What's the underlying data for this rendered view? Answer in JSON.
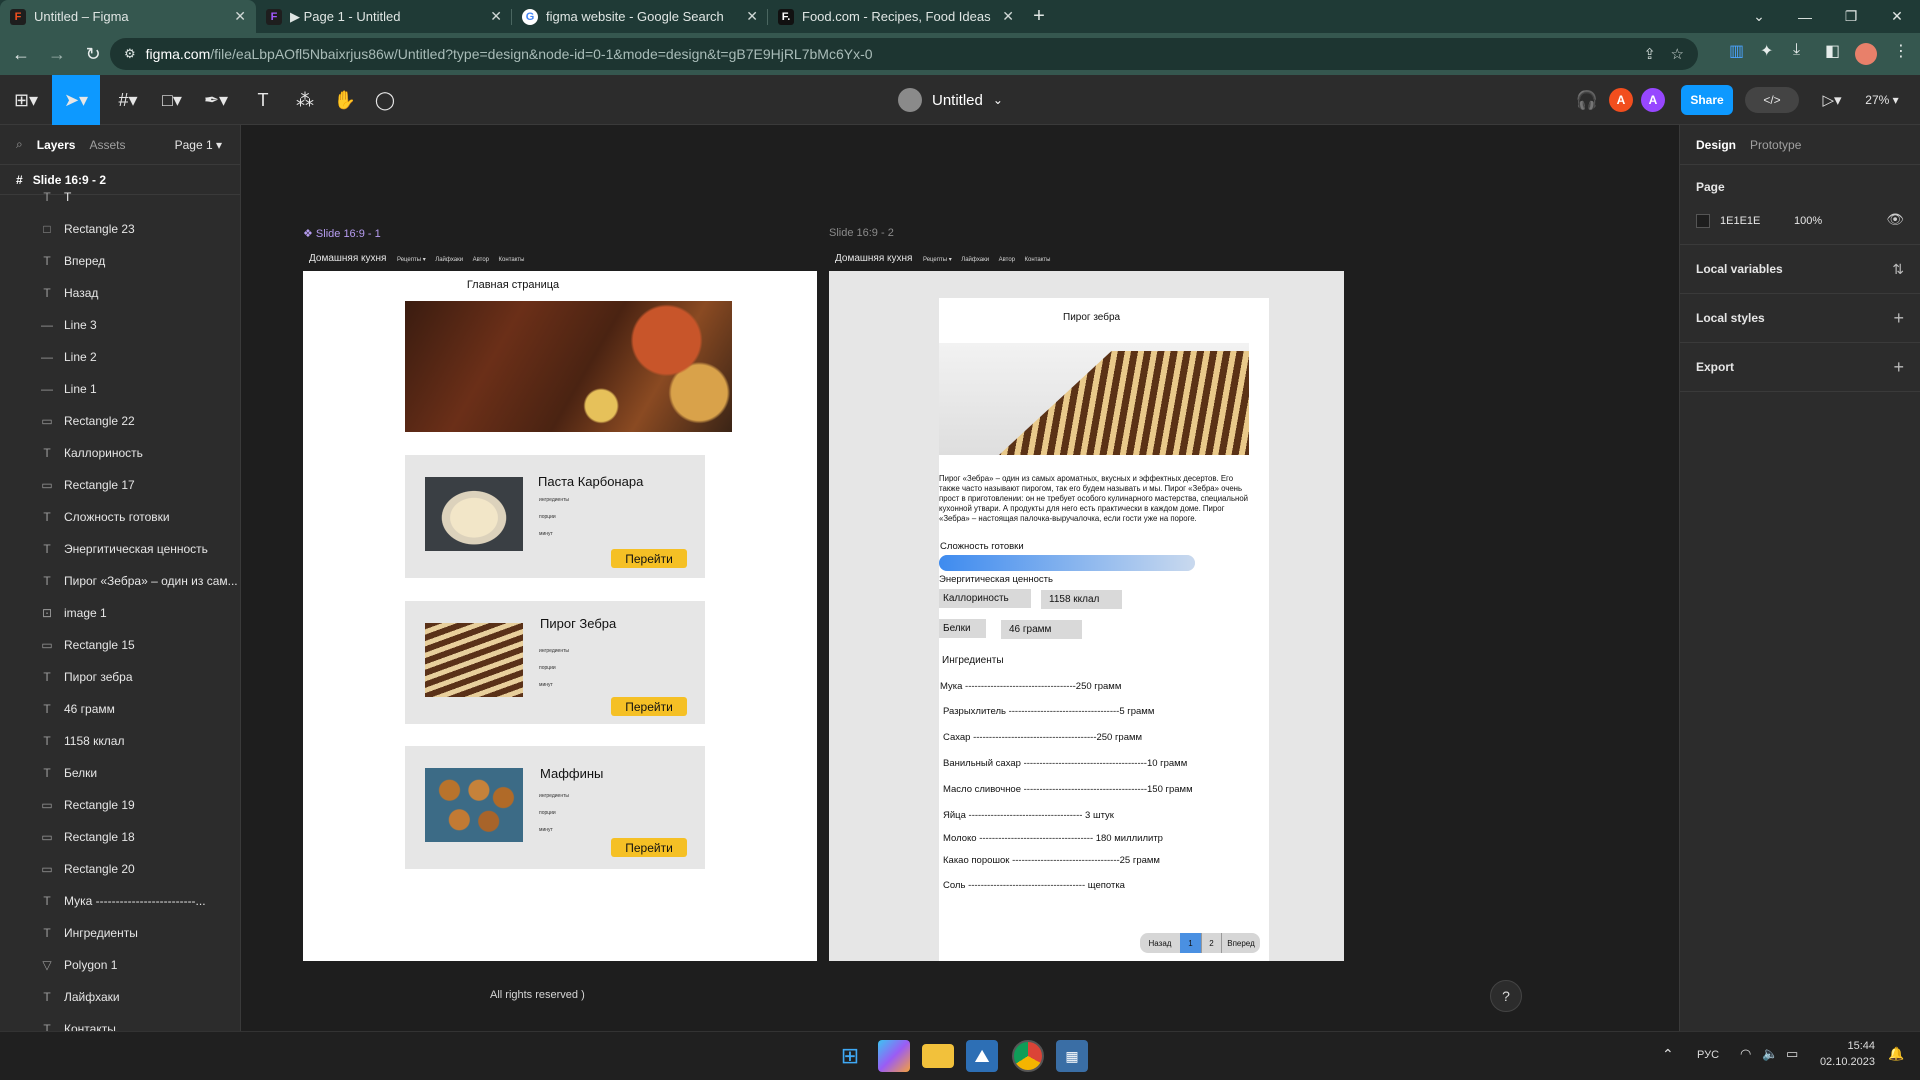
{
  "browser": {
    "tabs": [
      {
        "title": "Untitled – Figma",
        "active": true,
        "icon": "figma-icon"
      },
      {
        "title": "▶ Page 1 - Untitled",
        "active": false,
        "icon": "figma-icon"
      },
      {
        "title": "figma website - Google Search",
        "active": false,
        "icon": "google-icon"
      },
      {
        "title": "Food.com - Recipes, Food Ideas",
        "active": false,
        "icon": "food-icon"
      }
    ],
    "new_tab": "+",
    "window_controls": {
      "chevron": "⌄",
      "minimize": "—",
      "restore": "❐",
      "close": "✕"
    },
    "url_host": "figma.com",
    "url_rest": "/file/eaLbpAOfl5Nbaixrjus86w/Untitled?type=design&node-id=0-1&mode=design&t=gB7E9HjRL7bMc6Yx-0",
    "nav": {
      "back": "←",
      "forward": "→",
      "reload": "↻"
    }
  },
  "figma_toolbar": {
    "file_title": "Untitled",
    "file_chevron": "⌄",
    "share_label": "Share",
    "zoom": "27%",
    "avatars": [
      {
        "letter": "A",
        "color": "#f24e1e"
      },
      {
        "letter": "A",
        "color": "#9747ff"
      }
    ],
    "accent": "#0d99ff"
  },
  "left_panel": {
    "tab_layers": "Layers",
    "tab_assets": "Assets",
    "page_selector": "Page 1",
    "frame_name": "Slide 16:9 - 2",
    "layers": [
      {
        "name": "T",
        "icon": "T"
      },
      {
        "name": "Rectangle 23",
        "icon": "□"
      },
      {
        "name": "Вперед",
        "icon": "T"
      },
      {
        "name": "Назад",
        "icon": "T"
      },
      {
        "name": "Line 3",
        "icon": "—"
      },
      {
        "name": "Line 2",
        "icon": "—"
      },
      {
        "name": "Line 1",
        "icon": "—"
      },
      {
        "name": "Rectangle 22",
        "icon": "▭"
      },
      {
        "name": "Каллориность",
        "icon": "T"
      },
      {
        "name": "Rectangle 17",
        "icon": "▭"
      },
      {
        "name": "Сложность готовки",
        "icon": "T"
      },
      {
        "name": "Энергитическая ценность",
        "icon": "T"
      },
      {
        "name": "Пирог «Зебра» – один из сам...",
        "icon": "T"
      },
      {
        "name": "image 1",
        "icon": "⊡"
      },
      {
        "name": "Rectangle 15",
        "icon": "▭"
      },
      {
        "name": "Пирог зебра",
        "icon": "T"
      },
      {
        "name": "46 грамм",
        "icon": "T"
      },
      {
        "name": "1158 кклал",
        "icon": "T"
      },
      {
        "name": "Белки",
        "icon": "T"
      },
      {
        "name": "Rectangle 19",
        "icon": "▭"
      },
      {
        "name": "Rectangle 18",
        "icon": "▭"
      },
      {
        "name": "Rectangle 20",
        "icon": "▭"
      },
      {
        "name": "Мука -------------------------...",
        "icon": "T"
      },
      {
        "name": "Ингредиенты",
        "icon": "T"
      },
      {
        "name": "Polygon 1",
        "icon": "▽"
      },
      {
        "name": "Лайфхаки",
        "icon": "T"
      },
      {
        "name": "Контакты",
        "icon": "T"
      }
    ]
  },
  "right_panel": {
    "tab_design": "Design",
    "tab_prototype": "Prototype",
    "page_label": "Page",
    "page_color": "1E1E1E",
    "page_opacity": "100%",
    "sections": [
      "Local variables",
      "Local styles",
      "Export"
    ]
  },
  "slide1": {
    "label": "Slide 16:9 - 1",
    "nav_main": "Домашняя кухня",
    "nav_items": [
      "Рецепты ▾",
      "Лайфхаки",
      "Автор",
      "Контакты"
    ],
    "heading": "Главная страница",
    "cards": [
      {
        "title": "Паста Карбонара",
        "meta": [
          "ингредиенты",
          "порции",
          "минут"
        ],
        "button": "Перейти"
      },
      {
        "title": "Пирог Зебра",
        "meta": [
          "ингредиенты",
          "порции",
          "минут"
        ],
        "button": "Перейти"
      },
      {
        "title": "Маффины",
        "meta": [
          "ингредиенты",
          "порции",
          "минут"
        ],
        "button": "Перейти"
      }
    ],
    "footer": "All rights reserved )"
  },
  "slide2": {
    "label": "Slide 16:9 - 2",
    "nav_main": "Домашняя кухня",
    "nav_items": [
      "Рецепты ▾",
      "Лайфхаки",
      "Автор",
      "Контакты"
    ],
    "title": "Пирог зебра",
    "description": "Пирог «Зебра» – один из самых ароматных, вкусных и эффектных десертов. Его также часто называют пирогом, так его будем называть и мы. Пирог «Зебра» очень прост в приготовлении: он не требует особого кулинарного мастерства, специальной кухонной утвари. А продукты для него есть практически в каждом доме. Пирог «Зебра» – настоящая палочка-выручалочка, если гости уже на пороге.",
    "difficulty_label": "Сложность готовки",
    "energy_label": "Энергитическая ценность",
    "calories_label": "Каллориность",
    "calories_value": "1158 кклал",
    "protein_label": "Белки",
    "protein_value": "46 грамм",
    "ingredients_heading": "Ингредиенты",
    "ingredients": [
      "Мука -----------------------------------250 грамм",
      "Разрыхлитель -----------------------------------5 грамм",
      "Сахар ---------------------------------------250 грамм",
      "Ванильный сахар ---------------------------------------10 грамм",
      "Масло сливочное ---------------------------------------150 грамм",
      "Яйца ------------------------------------ 3 штук",
      "Молоко ------------------------------------ 180 миллилитр",
      "Какао порошок  ----------------------------------25 грамм",
      "Соль ------------------------------------- щепотка"
    ],
    "pagination": {
      "prev": "Назад",
      "pages": [
        "1",
        "2"
      ],
      "current": "1",
      "next": "Вперед"
    }
  },
  "taskbar": {
    "lang": "РУС",
    "time": "15:44",
    "date": "02.10.2023",
    "help": "?"
  }
}
